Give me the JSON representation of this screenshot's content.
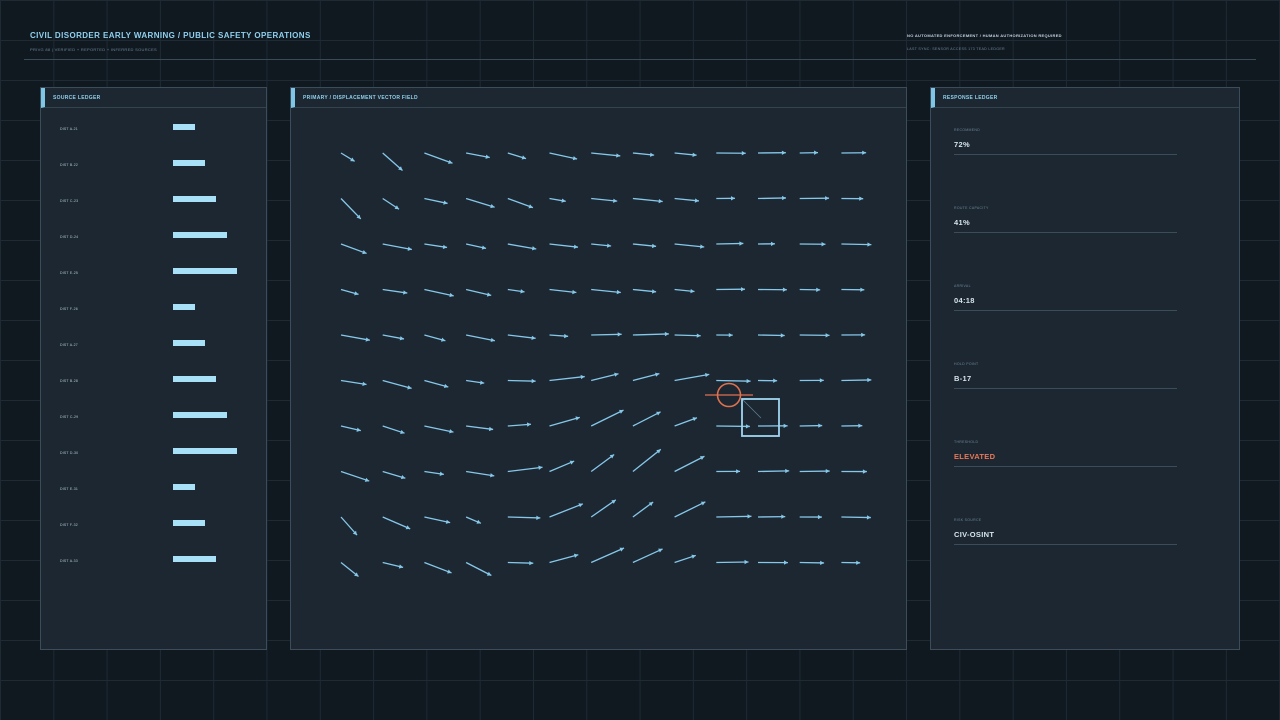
{
  "header": {
    "title": "CIVIL DISORDER EARLY WARNING / PUBLIC SAFETY OPERATIONS",
    "subtitle": "PRIVG 88  |  VERIFIED + REPORTED + INFERRED SOURCES",
    "notice": "NO AUTOMATED ENFORCEMENT / HUMAN AUTHORIZATION REQUIRED",
    "last_sync": "LAST SYNC: SENSOR ACCESS 173 TEAD LEDGER"
  },
  "source_ledger": {
    "title": "SOURCE LEDGER",
    "rows": [
      {
        "label": "DIST A-21",
        "level": 0.34
      },
      {
        "label": "DIST B-22",
        "level": 0.5
      },
      {
        "label": "DIST C-23",
        "level": 0.67
      },
      {
        "label": "DIST D-24",
        "level": 0.84
      },
      {
        "label": "DIST E-25",
        "level": 1.0
      },
      {
        "label": "DIST F-26",
        "level": 0.34
      },
      {
        "label": "DIST A-27",
        "level": 0.5
      },
      {
        "label": "DIST B-28",
        "level": 0.67
      },
      {
        "label": "DIST C-29",
        "level": 0.84
      },
      {
        "label": "DIST D-30",
        "level": 1.0
      },
      {
        "label": "DIST E-31",
        "level": 0.34
      },
      {
        "label": "DIST F-32",
        "level": 0.5
      },
      {
        "label": "DIST A-33",
        "level": 0.67
      }
    ]
  },
  "vector_field": {
    "title": "PRIMARY / DISPLACEMENT VECTOR FIELD",
    "arrow_color": "#86c8ea",
    "marker_color": "#e0714f",
    "selection_color": "#9fd6f2"
  },
  "response_ledger": {
    "title": "RESPONSE LEDGER",
    "metrics": [
      {
        "label": "RECOMMEND",
        "value": "72%",
        "status": "normal"
      },
      {
        "label": "ROUTE CAPACITY",
        "value": "41%",
        "status": "normal"
      },
      {
        "label": "ARRIVAL",
        "value": "04:18",
        "status": "normal"
      },
      {
        "label": "HOLD POINT",
        "value": "B-17",
        "status": "normal"
      },
      {
        "label": "THRESHOLD",
        "value": "ELEVATED",
        "status": "warning"
      },
      {
        "label": "RISK SOURCE",
        "value": "CIV-OSINT",
        "status": "normal"
      }
    ],
    "warning_color": "#e8785a"
  }
}
